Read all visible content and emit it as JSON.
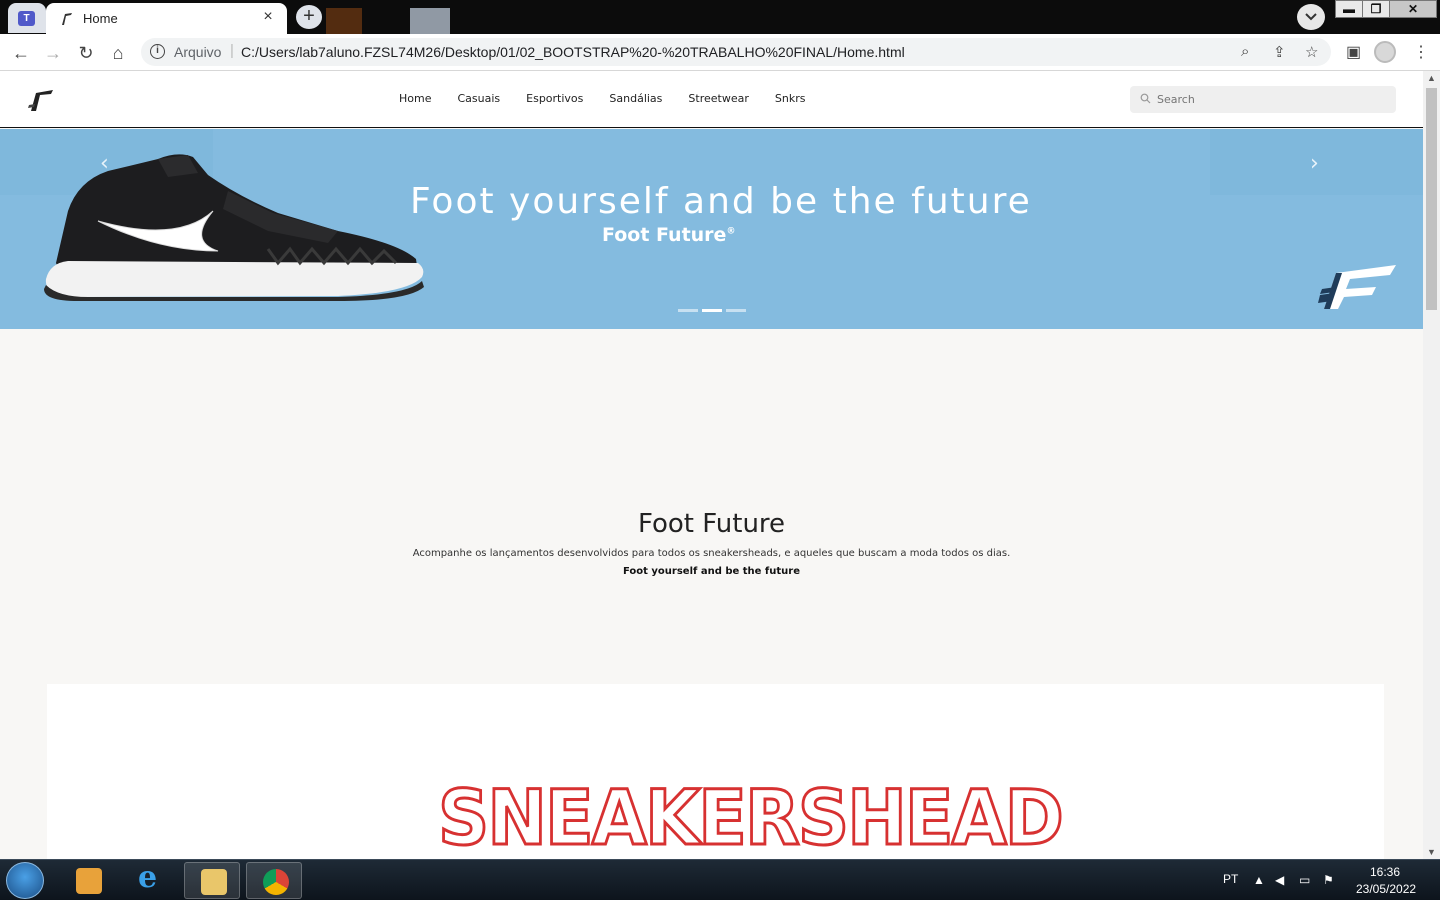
{
  "browser": {
    "active_tab_title": "Home",
    "tab_close": "×",
    "new_tab": "+",
    "scheme_label": "Arquivo",
    "url": "C:/Users/lab7aluno.FZSL74M26/Desktop/01/02_BOOTSTRAP%20-%20TRABALHO%20FINAL/Home.html",
    "window_controls": {
      "minimize": "▬",
      "maximize": "❐",
      "close": "✕"
    }
  },
  "site": {
    "nav": {
      "links": [
        "Home",
        "Casuais",
        "Esportivos",
        "Sandálias",
        "Streetwear",
        "Snkrs"
      ],
      "search_placeholder": "Search"
    },
    "carousel": {
      "title": "Foot yourself and be the future",
      "brand": "Foot Future",
      "brand_mark": "®",
      "prev_arrow": "‹",
      "next_arrow": "›",
      "slide_count": 3,
      "active_slide": 2
    },
    "about": {
      "title": "Foot Future",
      "text": "Acompanhe os lançamentos desenvolvidos para todos os sneakersheads, e aqueles que buscam a moda todos os dias.",
      "slogan": "Foot yourself and be the future"
    },
    "section_heading": "SNEAKERSHEAD"
  },
  "taskbar": {
    "language": "PT",
    "time": "16:36",
    "date": "23/05/2022"
  },
  "colors": {
    "hero_bg": "#84bbdf",
    "sneakerhead_outline": "#d73131",
    "page_bg": "#f8f7f5"
  }
}
